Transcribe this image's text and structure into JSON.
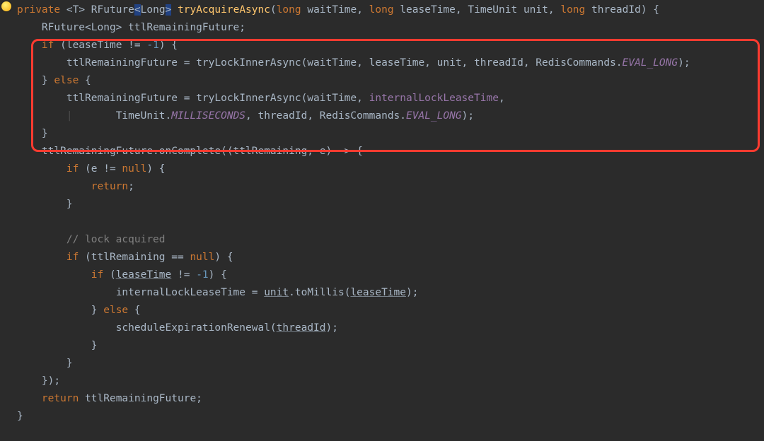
{
  "code": {
    "kw_private": "private",
    "generic_open": "<",
    "generic_t": "T",
    "generic_close": ">",
    "type_rfuture": "RFuture",
    "lt": "<",
    "type_long": "Long",
    "gt": ">",
    "method_name": "tryAcquireAsync",
    "lparen": "(",
    "p1_type": "long",
    "p1_name": "waitTime",
    "comma": ", ",
    "p2_type": "long",
    "p2_name": "leaseTime",
    "p3_type": "TimeUnit",
    "p3_name": "unit",
    "p4_type": "long",
    "p4_name": "threadId",
    "rparen": ")",
    "lbrace": " {",
    "decl_type": "RFuture<Long>",
    "decl_name": "ttlRemainingFuture",
    "semicolon": ";",
    "kw_if": "if",
    "cond1": " (leaseTime != ",
    "neg1": "-1",
    "cond1_end": ") {",
    "assign1_lhs": "ttlRemainingFuture = ",
    "call_inner": "tryLockInnerAsync",
    "args1a": "(waitTime, leaseTime, unit, threadId, RedisCommands.",
    "eval_long": "EVAL_LONG",
    "args1b": ");",
    "kw_else": "} else {",
    "args2a": "(waitTime, ",
    "field_illt": "internalLockLeaseTime",
    "args2a_end": ",",
    "line_cont1a": "TimeUnit.",
    "ms": "MILLISECONDS",
    "line_cont1b": ", threadId, RedisCommands.",
    "line_cont1c": ");",
    "rbrace": "}",
    "onComplete_lhs": "ttlRemainingFuture.onComplete((ttlRemaining, e) -> {",
    "if_e": "if",
    "if_e_cond": " (e != ",
    "kw_null": "null",
    "if_e_end": ") {",
    "kw_return": "return",
    "comment_lock": "// lock acquired",
    "if_ttl": "if",
    "if_ttl_cond": " (ttlRemaining == ",
    "if_ttl_end": ") {",
    "if_lease2": "if",
    "if_lease2_open": " (",
    "u_leaseTime": "leaseTime",
    "if_lease2_rest": " != ",
    "if_lease2_end": ") {",
    "assign_illt": "internalLockLeaseTime = ",
    "u_unit": "unit",
    "toMillis": ".toMillis(",
    "u_leaseTime2": "leaseTime",
    "toMillis_end": ");",
    "else2": "} else {",
    "sched_call": "scheduleExpirationRenewal(",
    "u_threadId": "threadId",
    "sched_end": ");",
    "close_inner": "}",
    "close_if_ttl": "}",
    "close_lambda": "});",
    "return_stmt": "return",
    "return_name": " ttlRemainingFuture;",
    "close_method": "}"
  }
}
